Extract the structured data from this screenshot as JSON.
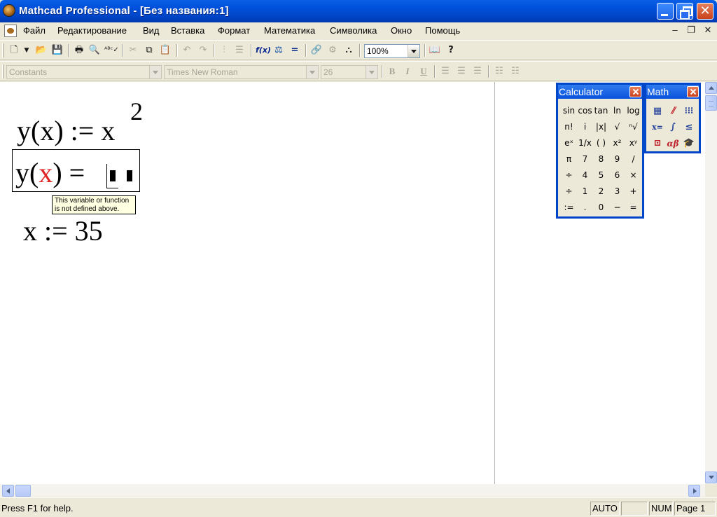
{
  "window": {
    "title": "Mathcad Professional - [Без названия:1]"
  },
  "menu": {
    "items": [
      "Файл",
      "Редактирование",
      "Вид",
      "Вставка",
      "Формат",
      "Математика",
      "Символика",
      "Окно",
      "Помощь"
    ]
  },
  "toolbar": {
    "zoom": "100%"
  },
  "formatting": {
    "style": "Constants",
    "font": "Times New Roman",
    "size": "26",
    "bold": "B",
    "italic": "I",
    "underline": "U"
  },
  "worksheet": {
    "eq1": "y(x) := x",
    "eq1_exponent": "2",
    "eq2_left": "y(",
    "eq2_var": "x",
    "eq2_right": ") =",
    "error_tooltip_line1": "This variable or function",
    "error_tooltip_line2": "is not defined above.",
    "eq3": "x := 35"
  },
  "calculator": {
    "title": "Calculator",
    "keys": [
      [
        "sin",
        "cos",
        "tan",
        "ln",
        "log"
      ],
      [
        "n!",
        "i",
        "|x|",
        "√",
        "ⁿ√"
      ],
      [
        "eˣ",
        "1/x",
        "( )",
        "x²",
        "xʸ"
      ],
      [
        "π",
        "7",
        "8",
        "9",
        "/"
      ],
      [
        "÷",
        "4",
        "5",
        "6",
        "×"
      ],
      [
        "÷",
        "1",
        "2",
        "3",
        "+"
      ],
      [
        ":=",
        ".",
        "0",
        "−",
        "="
      ]
    ]
  },
  "math_palette": {
    "title": "Math"
  },
  "status": {
    "help": "Press F1 for help.",
    "mode": "AUTO",
    "num": "NUM",
    "page": "Page 1"
  }
}
